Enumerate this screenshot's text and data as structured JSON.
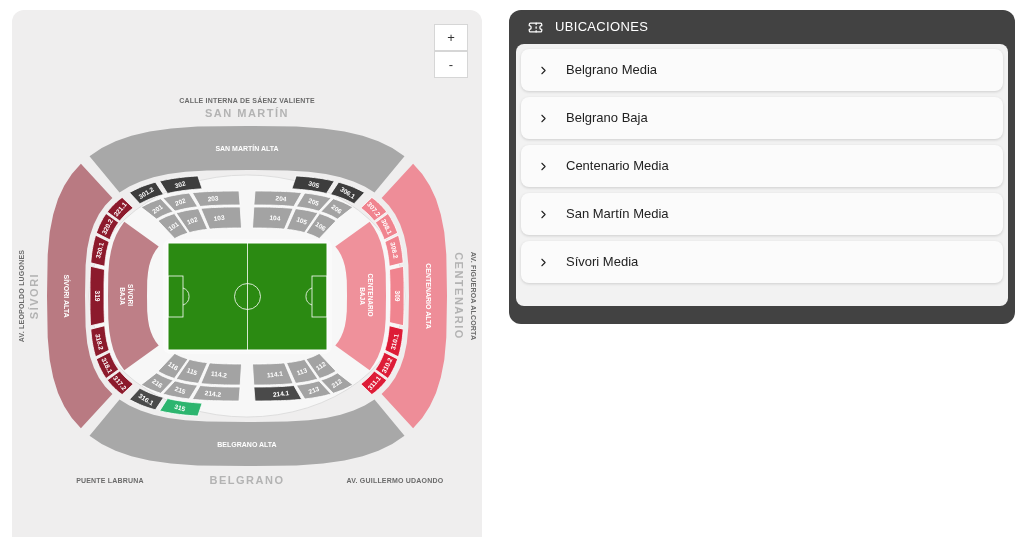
{
  "map": {
    "zoom_controls": [
      "+",
      "-"
    ],
    "stands": [
      {
        "name": "SAN MARTÍN",
        "streets": [
          "CALLE INTERNA DE SÁENZ VALIENTE"
        ],
        "upper": {
          "label": "SAN MARTÍN ALTA",
          "color": "#a8a8a8"
        },
        "ring3": [
          {
            "label": "301.2",
            "color": "#3d3d3d"
          },
          {
            "label": "302",
            "color": "#3d3d3d"
          },
          {
            "label": "305",
            "color": "#3d3d3d"
          },
          {
            "label": "306.1",
            "color": "#3d3d3d"
          }
        ],
        "ring2": [
          {
            "label": "201",
            "color": "#a3a3a3"
          },
          {
            "label": "202",
            "color": "#a3a3a3"
          },
          {
            "label": "203",
            "color": "#a3a3a3"
          },
          {
            "label": "204",
            "color": "#a3a3a3"
          },
          {
            "label": "205",
            "color": "#a3a3a3"
          },
          {
            "label": "206",
            "color": "#a3a3a3"
          }
        ],
        "ring1": [
          {
            "label": "101",
            "color": "#a3a3a3"
          },
          {
            "label": "102",
            "color": "#a3a3a3"
          },
          {
            "label": "103",
            "color": "#a3a3a3"
          },
          {
            "label": "104",
            "color": "#a3a3a3"
          },
          {
            "label": "105",
            "color": "#a3a3a3"
          },
          {
            "label": "106",
            "color": "#a3a3a3"
          }
        ]
      },
      {
        "name": "SÍVORI",
        "streets": [
          "AV. LEOPOLDO LUGONES"
        ],
        "upper": {
          "label": "SÍVORI ALTA",
          "color": "#b97a82"
        },
        "lower": {
          "label": "SÍVORI BAJA",
          "color": "#be7f87"
        },
        "ring3": [
          {
            "label": "321.1",
            "color": "#8c1a2c"
          },
          {
            "label": "320.2",
            "color": "#8c1a2c"
          },
          {
            "label": "320.1",
            "color": "#8c1a2c"
          },
          {
            "label": "319",
            "color": "#8c1a2c"
          },
          {
            "label": "318.2",
            "color": "#8c1a2c"
          },
          {
            "label": "318.1",
            "color": "#8c1a2c"
          },
          {
            "label": "317.2",
            "color": "#8c1a2c"
          }
        ]
      },
      {
        "name": "CENTENARIO",
        "streets": [
          "AV. FIGUEROA ALCORTA"
        ],
        "upper": {
          "label": "CENTENARIO ALTA",
          "color": "#ee8d98"
        },
        "lower": {
          "label": "CENTENARIO BAJA",
          "color": "#ef919b"
        },
        "ring3": [
          {
            "label": "307.2",
            "color": "#f0848f"
          },
          {
            "label": "308.1",
            "color": "#f0848f"
          },
          {
            "label": "308.2",
            "color": "#f0848f"
          },
          {
            "label": "309",
            "color": "#f0848f"
          },
          {
            "label": "310.1",
            "color": "#dd1c37"
          },
          {
            "label": "310.2",
            "color": "#dd1c37"
          },
          {
            "label": "311.1",
            "color": "#dd1c37"
          }
        ]
      },
      {
        "name": "BELGRANO",
        "streets": [
          "PUENTE LABRUNA",
          "AV. GUILLERMO UDAONDO"
        ],
        "upper": {
          "label": "BELGRANO ALTA",
          "color": "#a8a8a8"
        },
        "ring3": [
          {
            "label": "316.1",
            "color": "#4a4a4a"
          },
          {
            "label": "315",
            "color": "#2db56f"
          }
        ],
        "ring2": [
          {
            "label": "216",
            "color": "#a3a3a3"
          },
          {
            "label": "215",
            "color": "#a3a3a3"
          },
          {
            "label": "214.2",
            "color": "#a3a3a3"
          },
          {
            "label": "214.1",
            "color": "#4a4a4a"
          },
          {
            "label": "213",
            "color": "#a3a3a3"
          },
          {
            "label": "212",
            "color": "#a3a3a3"
          }
        ],
        "ring1": [
          {
            "label": "116",
            "color": "#a3a3a3"
          },
          {
            "label": "115",
            "color": "#a3a3a3"
          },
          {
            "label": "114.2",
            "color": "#a3a3a3"
          },
          {
            "label": "114.1",
            "color": "#a3a3a3"
          },
          {
            "label": "113",
            "color": "#a3a3a3"
          },
          {
            "label": "112",
            "color": "#a3a3a3"
          }
        ]
      }
    ]
  },
  "panel": {
    "title": "UBICACIONES",
    "items": [
      {
        "label": "Belgrano Media",
        "expanded": false
      },
      {
        "label": "Belgrano Baja",
        "expanded": false
      },
      {
        "label": "Centenario Media",
        "expanded": false
      },
      {
        "label": "San Martín Media",
        "expanded": false
      },
      {
        "label": "Sívori Media",
        "expanded": false
      }
    ]
  }
}
